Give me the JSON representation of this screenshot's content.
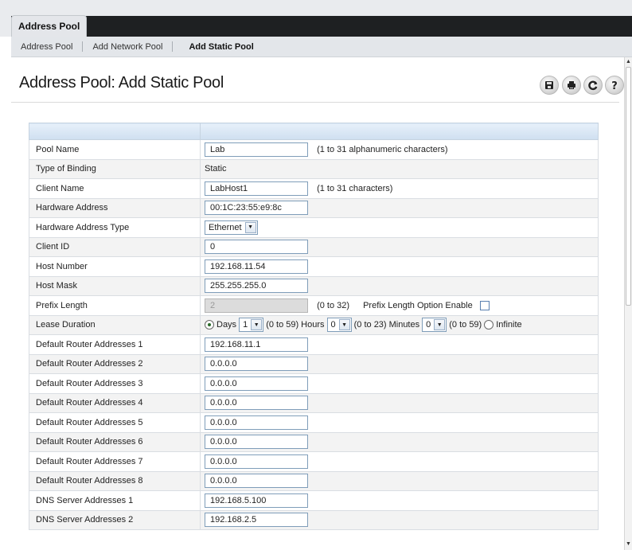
{
  "tabs": {
    "main_tab": "Address Pool"
  },
  "subnav": {
    "items": [
      "Address Pool",
      "Add Network Pool",
      "Add Static Pool"
    ]
  },
  "page": {
    "title": "Address Pool: Add Static Pool"
  },
  "toolbar": {
    "icons": [
      "save-icon",
      "print-icon",
      "refresh-icon",
      "help-icon"
    ]
  },
  "form": {
    "pool_name": {
      "label": "Pool Name",
      "value": "Lab",
      "hint": "(1 to 31 alphanumeric characters)"
    },
    "type_of_binding": {
      "label": "Type of Binding",
      "value": "Static"
    },
    "client_name": {
      "label": "Client Name",
      "value": "LabHost1",
      "hint": "(1 to 31 characters)"
    },
    "hardware_address": {
      "label": "Hardware Address",
      "value": "00:1C:23:55:e9:8c"
    },
    "hardware_address_type": {
      "label": "Hardware Address Type",
      "value": "Ethernet"
    },
    "client_id": {
      "label": "Client ID",
      "value": "0"
    },
    "host_number": {
      "label": "Host Number",
      "value": "192.168.11.54"
    },
    "host_mask": {
      "label": "Host Mask",
      "value": "255.255.255.0"
    },
    "prefix_length": {
      "label": "Prefix Length",
      "value": "2",
      "hint": "(0 to 32)",
      "option_label": "Prefix Length Option Enable",
      "option_checked": false
    },
    "lease_duration": {
      "label": "Lease Duration",
      "days_label": "Days",
      "days_value": "1",
      "days_range": "(0 to 59)",
      "hours_label": "Hours",
      "hours_value": "0",
      "hours_range": "(0 to 23)",
      "minutes_label": "Minutes",
      "minutes_value": "0",
      "minutes_range": "(0 to 59)",
      "infinite_label": "Infinite",
      "selected": "days"
    },
    "default_routers": [
      {
        "label": "Default Router Addresses 1",
        "value": "192.168.11.1"
      },
      {
        "label": "Default Router Addresses 2",
        "value": "0.0.0.0"
      },
      {
        "label": "Default Router Addresses 3",
        "value": "0.0.0.0"
      },
      {
        "label": "Default Router Addresses 4",
        "value": "0.0.0.0"
      },
      {
        "label": "Default Router Addresses 5",
        "value": "0.0.0.0"
      },
      {
        "label": "Default Router Addresses 6",
        "value": "0.0.0.0"
      },
      {
        "label": "Default Router Addresses 7",
        "value": "0.0.0.0"
      },
      {
        "label": "Default Router Addresses 8",
        "value": "0.0.0.0"
      }
    ],
    "dns_servers": [
      {
        "label": "DNS Server Addresses 1",
        "value": "192.168.5.100"
      },
      {
        "label": "DNS Server Addresses 2",
        "value": "192.168.2.5"
      }
    ]
  },
  "colors": {
    "tab_strip": "#1e2022",
    "subnav_bg": "#e3e6ea",
    "table_header": "#d6e4f3",
    "row_alt": "#f3f3f3",
    "input_border": "#7f9db9"
  }
}
